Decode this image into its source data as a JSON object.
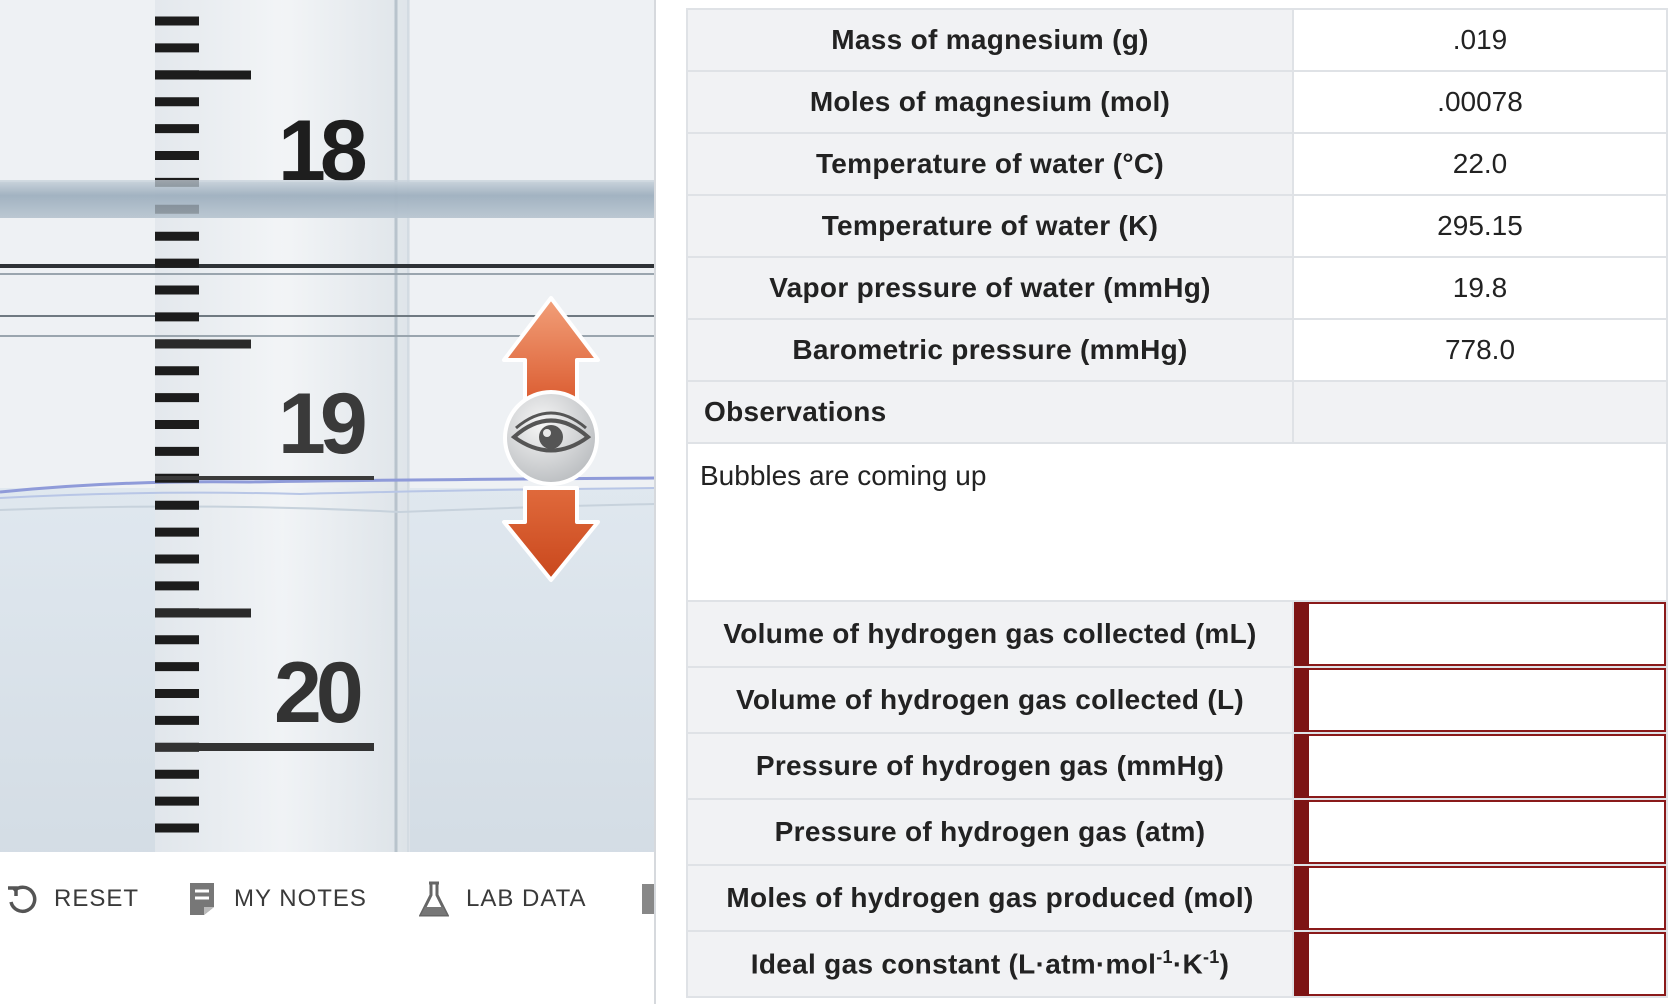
{
  "toolbar": {
    "reset_label": "RESET",
    "notes_label": "MY NOTES",
    "lab_data_label": "LAB DATA"
  },
  "simulation": {
    "scale_labels": [
      "18",
      "19",
      "20"
    ],
    "viewer_control_icon": "eye-icon"
  },
  "data_table": {
    "rows": [
      {
        "label": "Mass of magnesium (g)",
        "value": ".019"
      },
      {
        "label": "Moles of magnesium (mol)",
        "value": ".00078"
      },
      {
        "label": "Temperature of water (°C)",
        "value": "22.0"
      },
      {
        "label": "Temperature of water (K)",
        "value": "295.15"
      },
      {
        "label": "Vapor pressure of water (mmHg)",
        "value": "19.8"
      },
      {
        "label": "Barometric pressure (mmHg)",
        "value": "778.0"
      }
    ],
    "observations_label": "Observations",
    "observations_text": "Bubbles are coming up",
    "inputs": [
      {
        "label": "Volume of hydrogen gas collected (mL)",
        "value": ""
      },
      {
        "label": "Volume of hydrogen gas collected (L)",
        "value": ""
      },
      {
        "label": "Pressure of hydrogen gas (mmHg)",
        "value": ""
      },
      {
        "label": "Pressure of hydrogen gas (atm)",
        "value": ""
      },
      {
        "label": "Moles of hydrogen gas produced (mol)",
        "value": ""
      }
    ],
    "gas_constant": {
      "label_main": "Ideal gas constant (L",
      "dot": "·",
      "atm": "atm",
      "mol": "mol",
      "exp": "-1",
      "k": "K",
      "close": ")",
      "value": ""
    }
  },
  "colors": {
    "input_accent": "#7d1414",
    "label_bg": "#f1f2f4",
    "arrow_orange": "#e06a3c"
  }
}
